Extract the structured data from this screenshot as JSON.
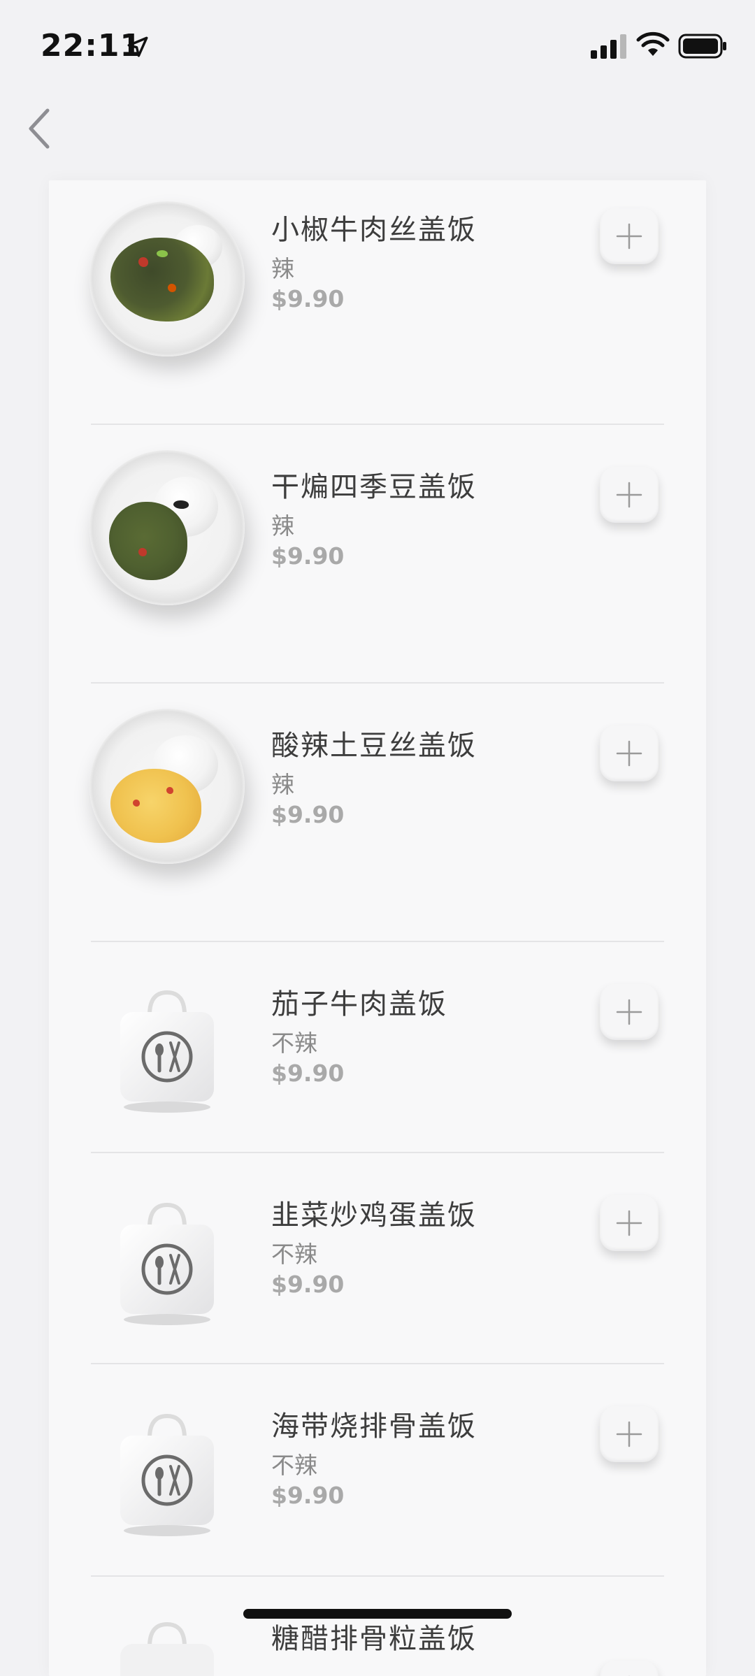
{
  "status_bar": {
    "time": "22:11"
  },
  "items": [
    {
      "name": "小椒牛肉丝盖饭",
      "spice": "辣",
      "price": "$9.90"
    },
    {
      "name": "干煸四季豆盖饭",
      "spice": "辣",
      "price": "$9.90"
    },
    {
      "name": "酸辣土豆丝盖饭",
      "spice": "辣",
      "price": "$9.90"
    },
    {
      "name": "茄子牛肉盖饭",
      "spice": "不辣",
      "price": "$9.90"
    },
    {
      "name": "韭菜炒鸡蛋盖饭",
      "spice": "不辣",
      "price": "$9.90"
    },
    {
      "name": "海带烧排骨盖饭",
      "spice": "不辣",
      "price": "$9.90"
    },
    {
      "name": "糖醋排骨粒盖饭"
    }
  ],
  "icons": {
    "back": "chevron-left-icon",
    "add": "plus-icon",
    "placeholder": "takeout-bag-icon"
  }
}
